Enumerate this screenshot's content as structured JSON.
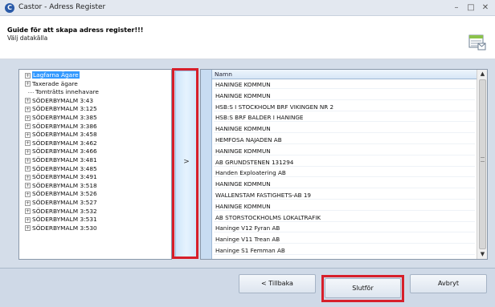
{
  "window": {
    "app_icon_letter": "C",
    "title": "Castor - Adress Register",
    "minimize_glyph": "–",
    "maximize_glyph": "□",
    "close_glyph": "✕"
  },
  "header": {
    "title": "Guide för att skapa adress register!!!",
    "subtitle": "Välj datakälla",
    "icon": "register-document-icon"
  },
  "tree": {
    "items": [
      {
        "label": "Lagfarna Ägare",
        "expandable": true,
        "selected": true
      },
      {
        "label": "Taxerade ägare",
        "expandable": true,
        "selected": false
      },
      {
        "label": "Tomträtts innehavare",
        "expandable": false,
        "selected": false
      },
      {
        "label": "SÖDERBYMALM 3:43",
        "expandable": true,
        "selected": false
      },
      {
        "label": "SÖDERBYMALM 3:125",
        "expandable": true,
        "selected": false
      },
      {
        "label": "SÖDERBYMALM 3:385",
        "expandable": true,
        "selected": false
      },
      {
        "label": "SÖDERBYMALM 3:386",
        "expandable": true,
        "selected": false
      },
      {
        "label": "SÖDERBYMALM 3:458",
        "expandable": true,
        "selected": false
      },
      {
        "label": "SÖDERBYMALM 3:462",
        "expandable": true,
        "selected": false
      },
      {
        "label": "SÖDERBYMALM 3:466",
        "expandable": true,
        "selected": false
      },
      {
        "label": "SÖDERBYMALM 3:481",
        "expandable": true,
        "selected": false
      },
      {
        "label": "SÖDERBYMALM 3:485",
        "expandable": true,
        "selected": false
      },
      {
        "label": "SÖDERBYMALM 3:491",
        "expandable": true,
        "selected": false
      },
      {
        "label": "SÖDERBYMALM 3:518",
        "expandable": true,
        "selected": false
      },
      {
        "label": "SÖDERBYMALM 3:526",
        "expandable": true,
        "selected": false
      },
      {
        "label": "SÖDERBYMALM 3:527",
        "expandable": true,
        "selected": false
      },
      {
        "label": "SÖDERBYMALM 3:532",
        "expandable": true,
        "selected": false
      },
      {
        "label": "SÖDERBYMALM 3:531",
        "expandable": true,
        "selected": false
      },
      {
        "label": "SÖDERBYMALM 3:530",
        "expandable": true,
        "selected": false
      }
    ]
  },
  "transfer_button": {
    "label": ">"
  },
  "list": {
    "column_header": "Namn",
    "rows": [
      "HANINGE KOMMUN",
      "HANINGE KOMMUN",
      "HSB:S I STOCKHOLM BRF VIKINGEN NR 2",
      "HSB:S BRF BALDER I HANINGE",
      "HANINGE KOMMUN",
      "HEMFOSA NAJADEN AB",
      "HANINGE KOMMUN",
      "AB GRUNDSTENEN 131294",
      "Handen Exploatering AB",
      "HANINGE KOMMUN",
      "WALLENSTAM FASTIGHETS-AB 19",
      "HANINGE KOMMUN",
      "AB STORSTOCKHOLMS LOKALTRAFIK",
      "Haninge V12 Fyran AB",
      "Haninge V11 Trean AB",
      "Haninge S1 Femman AB"
    ],
    "scroll_up_glyph": "▲",
    "scroll_down_glyph": "▼"
  },
  "footer": {
    "back_label": "< Tillbaka",
    "finish_label": "Slutför",
    "cancel_label": "Avbryt"
  },
  "colors": {
    "highlight_red": "#d71f2a",
    "selection_blue": "#3399ff"
  }
}
